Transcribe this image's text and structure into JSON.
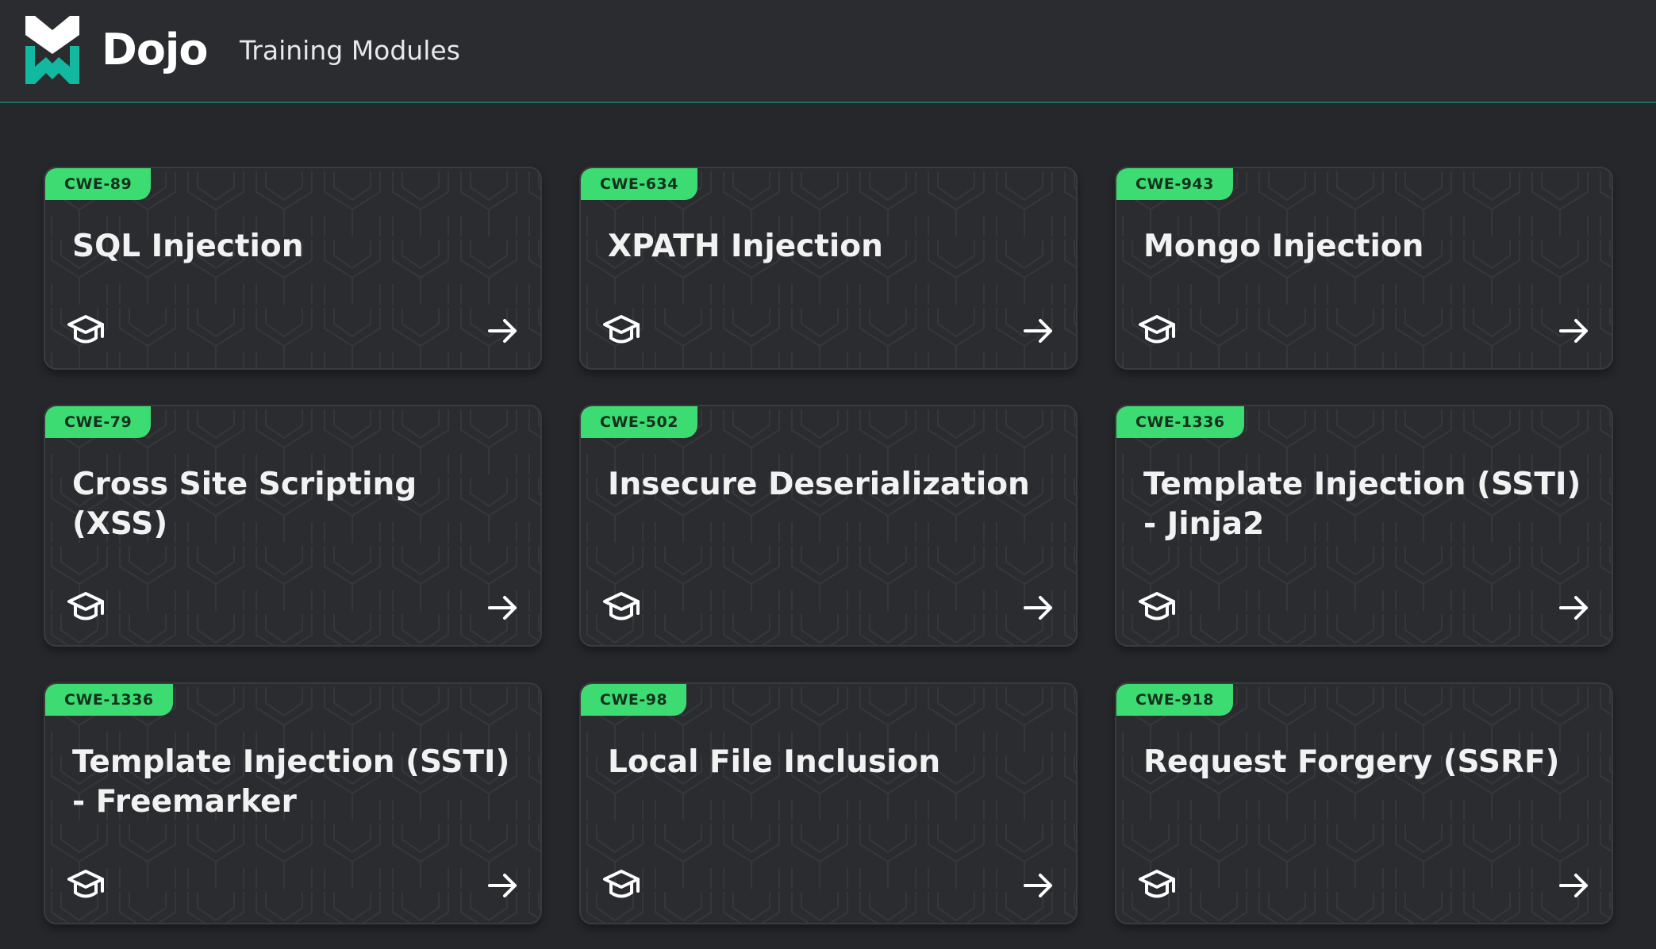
{
  "header": {
    "brand": "Dojo",
    "title": "Training Modules"
  },
  "colors": {
    "accent": "#3ddc73",
    "background": "#26272a",
    "card": "#2b2c30",
    "header_border": "#1d6f62"
  },
  "modules": [
    {
      "tag": "CWE-89",
      "title": "SQL Injection"
    },
    {
      "tag": "CWE-634",
      "title": "XPATH Injection"
    },
    {
      "tag": "CWE-943",
      "title": "Mongo Injection"
    },
    {
      "tag": "CWE-79",
      "title": "Cross Site Scripting (XSS)"
    },
    {
      "tag": "CWE-502",
      "title": "Insecure Deserialization"
    },
    {
      "tag": "CWE-1336",
      "title": "Template Injection (SSTI) - Jinja2"
    },
    {
      "tag": "CWE-1336",
      "title": "Template Injection (SSTI) - Freemarker"
    },
    {
      "tag": "CWE-98",
      "title": "Local File Inclusion"
    },
    {
      "tag": "CWE-918",
      "title": "Request Forgery (SSRF)"
    }
  ]
}
